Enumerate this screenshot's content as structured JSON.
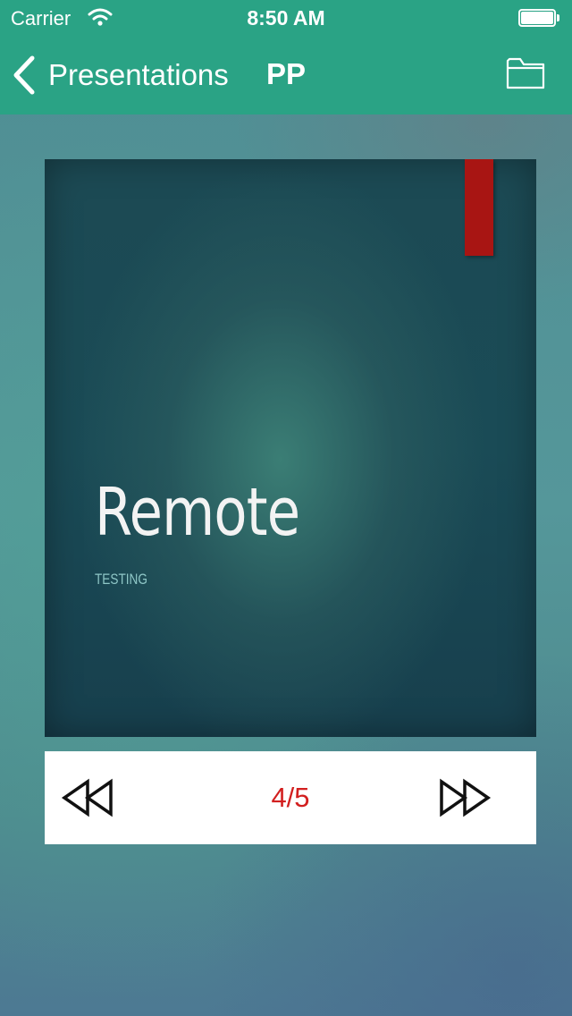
{
  "status_bar": {
    "carrier": "Carrier",
    "time": "8:50 AM"
  },
  "nav": {
    "back_label": "Presentations",
    "title": "PP",
    "background_color": "#2aa385",
    "folder_icon": "folder-icon"
  },
  "slide": {
    "title": "Remote",
    "subtitle": "TESTING",
    "ribbon_color": "#a81513"
  },
  "controls": {
    "rewind_icon": "rewind-icon",
    "forward_icon": "fast-forward-icon",
    "page_counter": "4/5",
    "counter_color": "#d21f1f"
  }
}
